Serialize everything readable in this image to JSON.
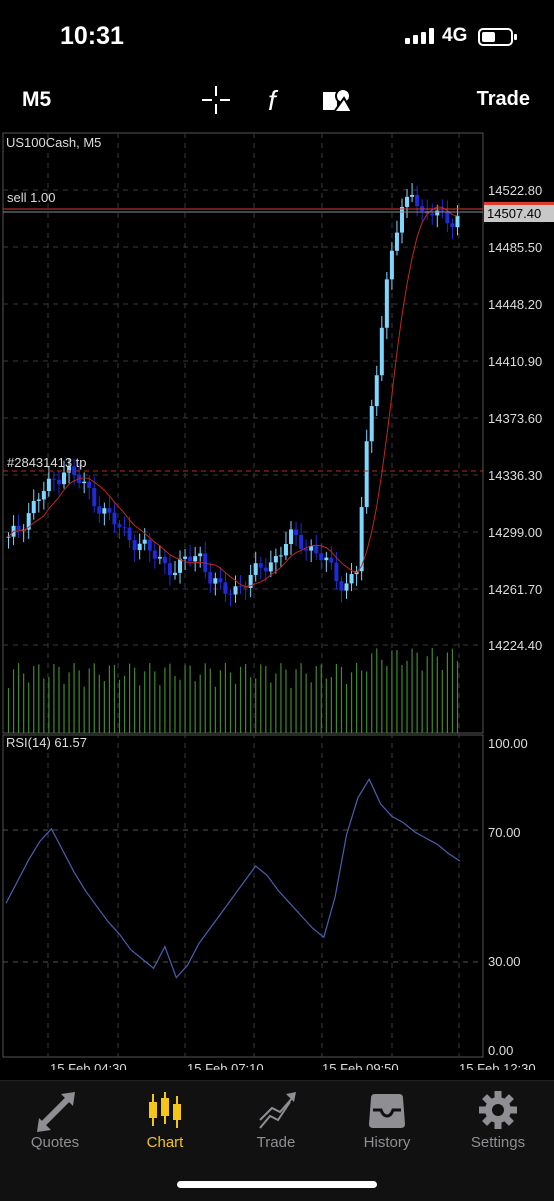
{
  "status_bar": {
    "time": "10:31",
    "network": "4G"
  },
  "toolbar": {
    "timeframe": "M5",
    "trade_label": "Trade"
  },
  "chart": {
    "symbol_label": "US100Cash, M5",
    "order_line_label": "sell 1.00",
    "tp_line_label": "#28431413 tp",
    "current_price": "14507.40",
    "price_ticks": [
      "14522.80",
      "14485.50",
      "14448.20",
      "14410.90",
      "14373.60",
      "14336.30",
      "14299.00",
      "14261.70",
      "14224.40"
    ],
    "indicator_label": "RSI(14) 61.57",
    "rsi_ticks": [
      "100.00",
      "70.00",
      "30.00",
      "0.00"
    ],
    "time_labels": [
      "15 Feb 04:30",
      "15 Feb 07:10",
      "15 Feb 09:50",
      "15 Feb 12:30"
    ],
    "colors": {
      "bull": "#7fd6ff",
      "bear": "#1f2bd9",
      "ma": "#c0281e",
      "sell_line": "#e03a2f",
      "rsi": "#4a5fb0",
      "volume": "#3f8a2e"
    }
  },
  "chart_data": {
    "type": "line",
    "title": "US100Cash, M5",
    "x": [
      "15 Feb 04:30",
      "15 Feb 07:10",
      "15 Feb 09:50",
      "15 Feb 12:30"
    ],
    "close_series": [
      14290,
      14300,
      14312,
      14322,
      14330,
      14340,
      14332,
      14325,
      14315,
      14305,
      14298,
      14292,
      14286,
      14280,
      14275,
      14270,
      14278,
      14282,
      14265,
      14255,
      14258,
      14262,
      14268,
      14275,
      14280,
      14292,
      14290,
      14285,
      14278,
      14268,
      14260,
      14270,
      14360,
      14420,
      14480,
      14510,
      14530,
      14505,
      14512,
      14508,
      14507
    ],
    "rsi_series": [
      48,
      55,
      62,
      68,
      72,
      65,
      58,
      52,
      47,
      42,
      38,
      33,
      30,
      27,
      34,
      24,
      28,
      35,
      40,
      45,
      50,
      55,
      60,
      57,
      52,
      48,
      44,
      40,
      37,
      50,
      70,
      82,
      88,
      80,
      76,
      74,
      71,
      69,
      67,
      64,
      61.57
    ],
    "ylim_price": [
      14210,
      14560
    ],
    "ylim_rsi": [
      0,
      100
    ],
    "current_price": 14507.4,
    "sell_price": 14515.0,
    "tp_price": 14338.5
  },
  "tabs": [
    {
      "label": "Quotes",
      "icon": "quotes-icon"
    },
    {
      "label": "Chart",
      "icon": "chart-icon"
    },
    {
      "label": "Trade",
      "icon": "trade-icon"
    },
    {
      "label": "History",
      "icon": "history-icon"
    },
    {
      "label": "Settings",
      "icon": "settings-icon"
    }
  ]
}
